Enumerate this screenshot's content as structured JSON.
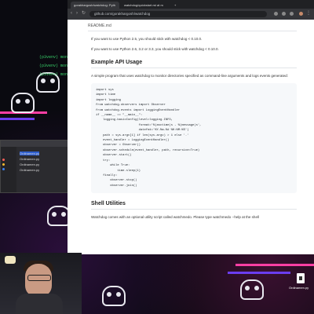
{
  "terminal": {
    "lines": [
      "(p3venv) mon",
      "(p3venv) mon",
      "(p3venv) mon"
    ]
  },
  "finder": {
    "files": [
      "Ordinamen.py",
      "Ordinamen.py",
      "Ordinamen.py",
      "Ordinamen.py"
    ]
  },
  "browser": {
    "tabs": [
      "gorakhargosh/watchdog: Pyth",
      "watchdog/quickstart.rst at m",
      ""
    ],
    "url": "github.com/gorakhargosh/watchdog"
  },
  "readme": {
    "header": "README.md",
    "py25": "If you want to use Python 2.5, you should stick with watchdog < 0.10.0.",
    "py2634": "If you want to use Python 2.6, 3.2 or 3.3, you should stick with watchdog < 0.10.0.",
    "section1": "Example API Usage",
    "intro": "A simple program that uses watchdog to monitor directories specified as command-line arguments and logs events generated:",
    "code": [
      "import sys",
      "import time",
      "import logging",
      "from watchdog.observers import Observer",
      "from watchdog.events import LoggingEventHandler",
      "",
      "if __name__ == \"__main__\":",
      "    logging.basicConfig(level=logging.INFO,",
      "                        format='%(asctime)s - %(message)s',",
      "                        datefmt='%Y-%m-%d %H:%M:%S')",
      "    path = sys.argv[1] if len(sys.argv) > 1 else '.'",
      "    event_handler = LoggingEventHandler()",
      "    observer = Observer()",
      "    observer.schedule(event_handler, path, recursive=True)",
      "    observer.start()",
      "    try:",
      "        while True:",
      "            time.sleep(1)",
      "    finally:",
      "        observer.stop()",
      "        observer.join()"
    ],
    "section2": "Shell Utilities",
    "shell": "Watchdog comes with an optional utility script called watchmedo. Please type watchmedo --help at the shell"
  },
  "desktop": {
    "file_label": "Ordinamen.py"
  }
}
